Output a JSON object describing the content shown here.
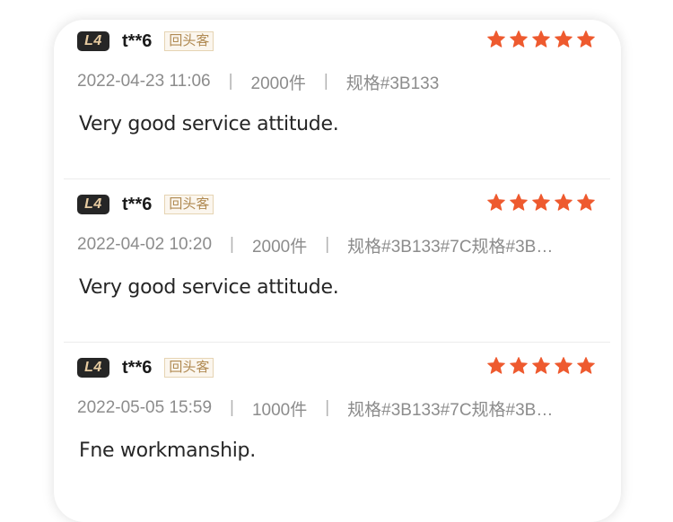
{
  "reviews": [
    {
      "level": "L4",
      "username": "t**6",
      "tag": "回头客",
      "rating": 5,
      "date": "2022-04-23 11:06",
      "quantity": "2000件",
      "spec": "规格#3B133",
      "content": "Very good service attitude."
    },
    {
      "level": "L4",
      "username": "t**6",
      "tag": "回头客",
      "rating": 5,
      "date": "2022-04-02 10:20",
      "quantity": "2000件",
      "spec": "规格#3B133#7C规格#3B…",
      "content": "Very good service attitude."
    },
    {
      "level": "L4",
      "username": "t**6",
      "tag": "回头客",
      "rating": 5,
      "date": "2022-05-05 15:59",
      "quantity": "1000件",
      "spec": "规格#3B133#7C规格#3B…",
      "content": "Fne workmanship."
    }
  ],
  "meta_separator": "|",
  "colors": {
    "star": "#ee5a2f",
    "badge_bg": "#262626",
    "badge_text": "#e7cba0"
  },
  "icons": {
    "star": "star-icon"
  }
}
